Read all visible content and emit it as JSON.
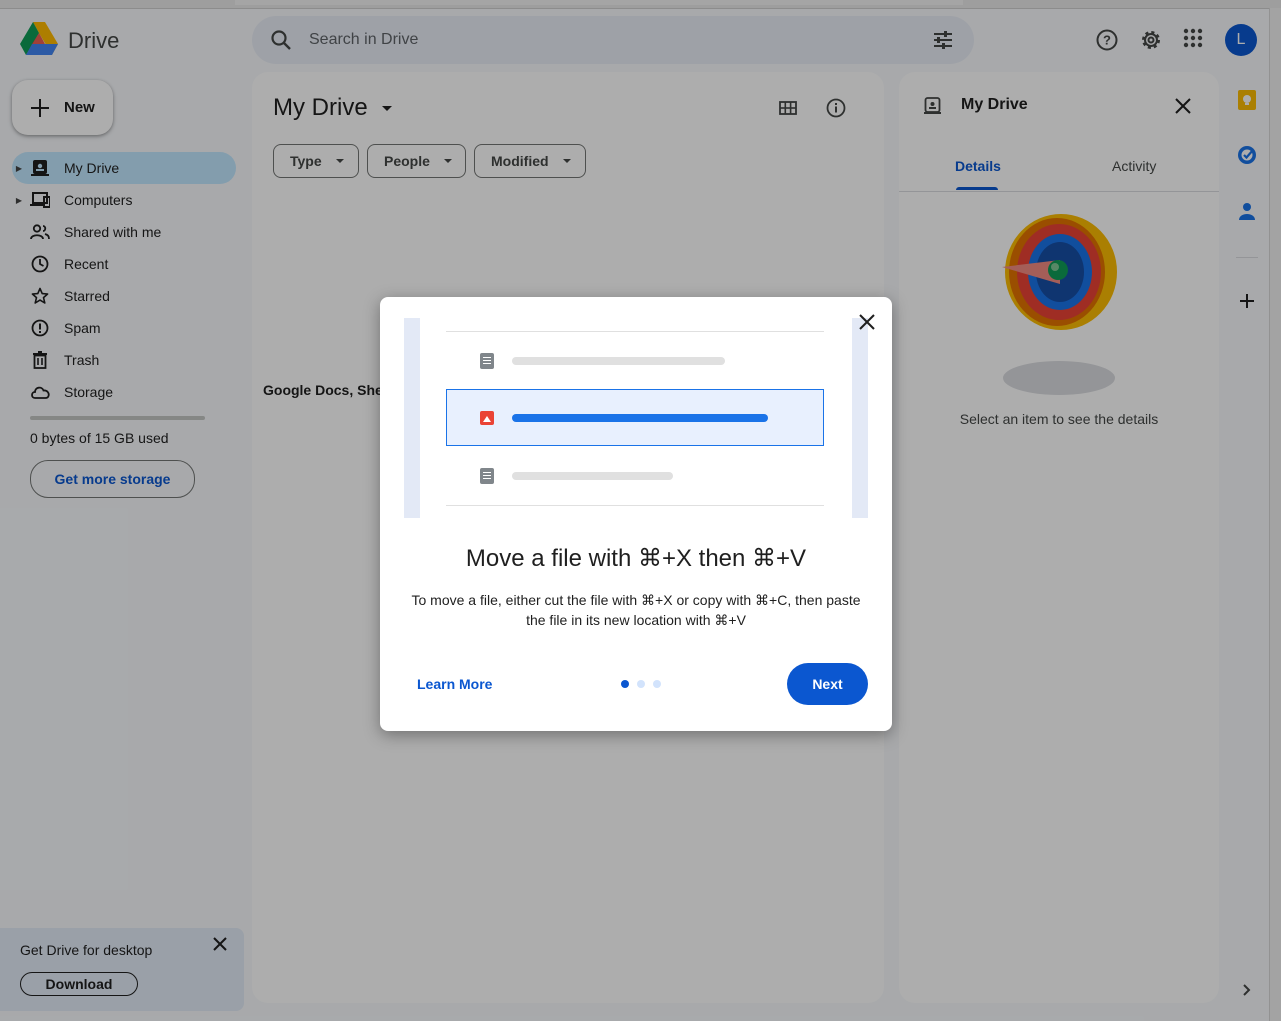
{
  "app": {
    "name": "Drive",
    "user_initial": "L"
  },
  "search": {
    "placeholder": "Search in Drive"
  },
  "sidebar": {
    "new_label": "New",
    "items": [
      {
        "label": "My Drive",
        "icon": "my-drive-icon",
        "active": true,
        "expandable": true
      },
      {
        "label": "Computers",
        "icon": "computers-icon",
        "active": false,
        "expandable": true
      },
      {
        "label": "Shared with me",
        "icon": "people-icon",
        "active": false,
        "expandable": false
      },
      {
        "label": "Recent",
        "icon": "clock-icon",
        "active": false,
        "expandable": false
      },
      {
        "label": "Starred",
        "icon": "star-icon",
        "active": false,
        "expandable": false
      },
      {
        "label": "Spam",
        "icon": "spam-icon",
        "active": false,
        "expandable": false
      },
      {
        "label": "Trash",
        "icon": "trash-icon",
        "active": false,
        "expandable": false
      },
      {
        "label": "Storage",
        "icon": "cloud-icon",
        "active": false,
        "expandable": false
      }
    ],
    "storage_used": 0,
    "storage_text": "0 bytes of 15 GB used",
    "get_more_label": "Get more storage"
  },
  "desktop_promo": {
    "title": "Get Drive for desktop",
    "download_label": "Download"
  },
  "main": {
    "title": "My Drive",
    "filters": [
      "Type",
      "People",
      "Modified"
    ],
    "empty_text": "Google Docs, She"
  },
  "details_panel": {
    "title": "My Drive",
    "tabs": [
      "Details",
      "Activity"
    ],
    "active_tab": "Details",
    "empty_text": "Select an item to see the details"
  },
  "dialog": {
    "heading": "Move a file with ⌘+X then ⌘+V",
    "body": "To move a file, either cut the file with ⌘+X or copy with ⌘+C, then paste the file in its new location with ⌘+V",
    "learn_more_label": "Learn More",
    "next_label": "Next",
    "page_count": 3,
    "current_page": 1
  },
  "colors": {
    "accent": "#0b57d0",
    "active_nav": "#c2e7ff",
    "search_bg": "#e9eef6"
  }
}
